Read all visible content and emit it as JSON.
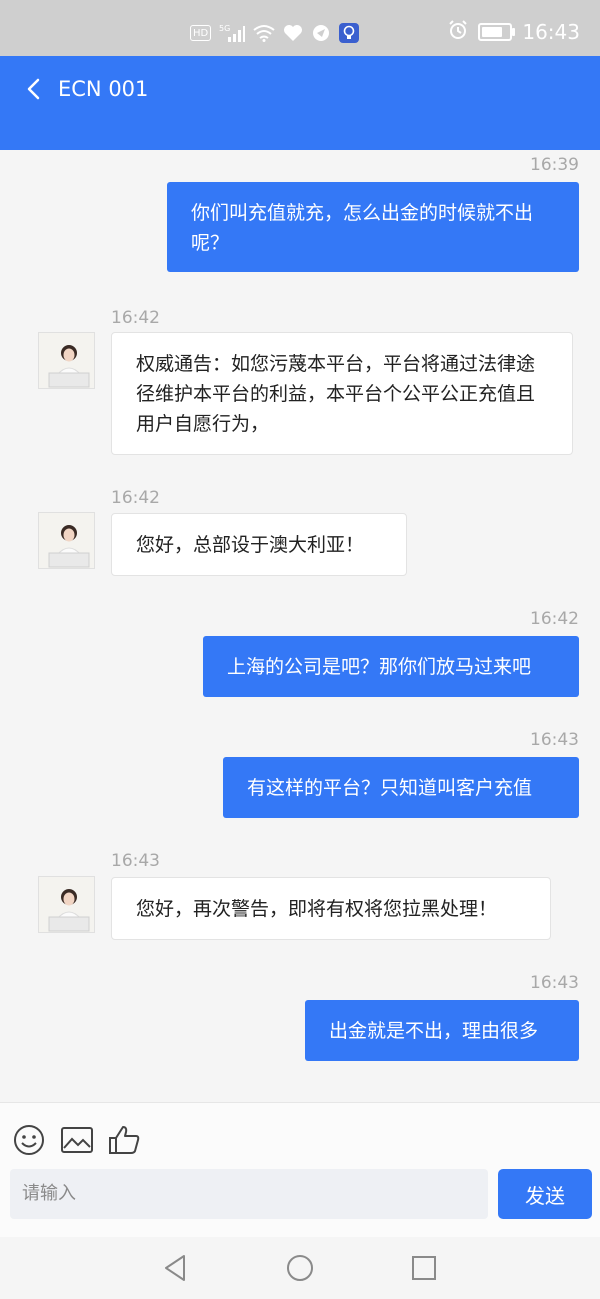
{
  "status_bar": {
    "time": "16:43",
    "network_label": "HD",
    "signal_label": "5G",
    "battery_level": 0.9,
    "icons": [
      "hd-icon",
      "signal-5g-icon",
      "wifi-icon",
      "heart-icon",
      "vpn-icon",
      "bulb-icon",
      "alarm-icon",
      "battery-icon"
    ]
  },
  "header": {
    "title": "ECN 001",
    "back_icon": "chevron-left-icon"
  },
  "messages": [
    {
      "time": "16:39",
      "side": "out",
      "text": "你们叫充值就充，怎么出金的时候就不出呢？"
    },
    {
      "time": "16:42",
      "side": "in",
      "text": "权威通告：如您污蔑本平台，平台将通过法律途径维护本平台的利益，本平台个公平公正充值且用户自愿行为，"
    },
    {
      "time": "16:42",
      "side": "in",
      "text": "您好，总部设于澳大利亚！"
    },
    {
      "time": "16:42",
      "side": "out",
      "text": "上海的公司是吧？那你们放马过来吧"
    },
    {
      "time": "16:43",
      "side": "out",
      "text": "有这样的平台？只知道叫客户充值"
    },
    {
      "time": "16:43",
      "side": "in",
      "text": "您好，再次警告，即将有权将您拉黑处理！"
    },
    {
      "time": "16:43",
      "side": "out",
      "text": "出金就是不出，理由很多"
    }
  ],
  "composer": {
    "placeholder": "请输入",
    "send_label": "发送",
    "tools": [
      "emoji-icon",
      "image-icon",
      "thumbs-up-icon"
    ]
  },
  "nav": {
    "icons": [
      "back-triangle-icon",
      "home-circle-icon",
      "recents-square-icon"
    ]
  },
  "colors": {
    "accent": "#3478f6",
    "status_bar": "#cfcfcf",
    "background": "#f5f5f5"
  }
}
